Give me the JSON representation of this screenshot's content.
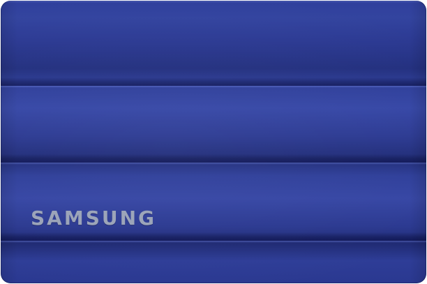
{
  "product": {
    "brand_text": "SAMSUNG"
  },
  "colors": {
    "body": "#2c3a93",
    "logo": "#9aa3b8",
    "background": "#ffffff"
  }
}
